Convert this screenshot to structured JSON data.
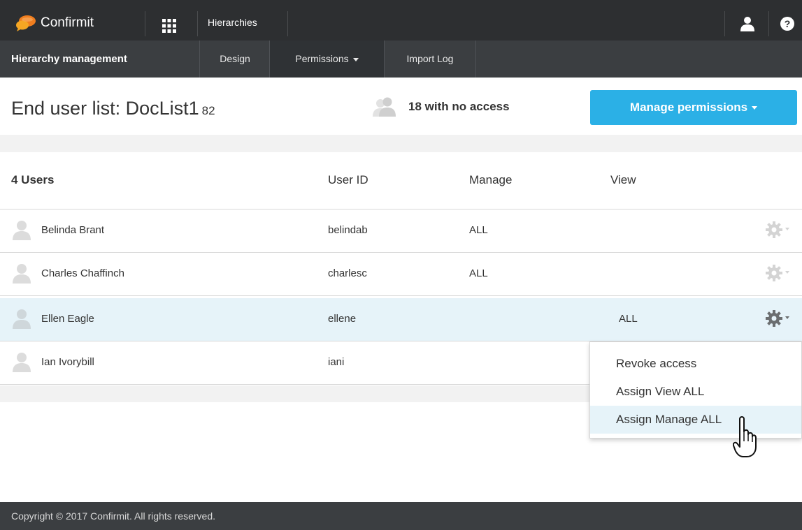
{
  "app": {
    "brand": "Confirmit",
    "module": "Hierarchies"
  },
  "subnav": {
    "title": "Hierarchy management",
    "items": [
      {
        "label": "Design"
      },
      {
        "label": "Permissions"
      },
      {
        "label": "Import Log"
      }
    ]
  },
  "header": {
    "title": "End user list: DocList1",
    "count": "82",
    "no_access": "18 with no access",
    "manage_button": "Manage permissions"
  },
  "table": {
    "headers": {
      "users": "4 Users",
      "user_id": "User ID",
      "manage": "Manage",
      "view": "View"
    },
    "rows": [
      {
        "name": "Belinda Brant",
        "user_id": "belindab",
        "manage": "ALL",
        "view": ""
      },
      {
        "name": "Charles Chaffinch",
        "user_id": "charlesc",
        "manage": "ALL",
        "view": ""
      },
      {
        "name": "Ellen Eagle",
        "user_id": "ellene",
        "manage": "",
        "view": "ALL"
      },
      {
        "name": "Ian Ivorybill",
        "user_id": "iani",
        "manage": "",
        "view": ""
      }
    ]
  },
  "context_menu": {
    "items": [
      {
        "label": "Revoke access"
      },
      {
        "label": "Assign View ALL"
      },
      {
        "label": "Assign Manage ALL"
      }
    ]
  },
  "footer": {
    "copyright": "Copyright © 2017 Confirmit. All rights reserved."
  },
  "colors": {
    "accent": "#2bb0e6",
    "topbar": "#2d2f31",
    "subnav": "#3b3e41",
    "row_highlight": "#e6f3f9",
    "logo_orange": "#f07d1e"
  }
}
